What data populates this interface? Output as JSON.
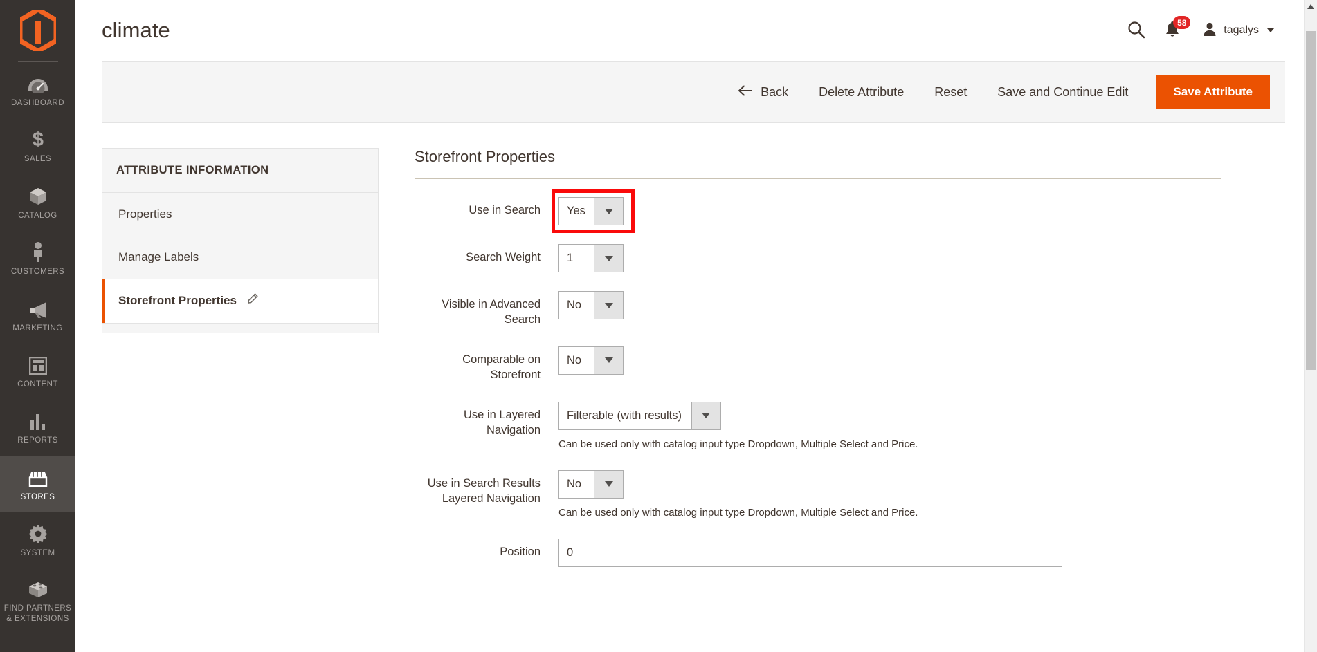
{
  "sidebar": {
    "logo": "magento-logo",
    "items": [
      {
        "label": "DASHBOARD",
        "icon": "dashboard-icon",
        "active": false
      },
      {
        "label": "SALES",
        "icon": "dollar-icon",
        "active": false
      },
      {
        "label": "CATALOG",
        "icon": "box-icon",
        "active": false
      },
      {
        "label": "CUSTOMERS",
        "icon": "person-icon",
        "active": false
      },
      {
        "label": "MARKETING",
        "icon": "megaphone-icon",
        "active": false
      },
      {
        "label": "CONTENT",
        "icon": "layout-icon",
        "active": false
      },
      {
        "label": "REPORTS",
        "icon": "bar-chart-icon",
        "active": false
      },
      {
        "label": "STORES",
        "icon": "storefront-icon",
        "active": true
      },
      {
        "label": "SYSTEM",
        "icon": "gear-icon",
        "active": false
      },
      {
        "label": "FIND PARTNERS\n& EXTENSIONS",
        "icon": "puzzle-block-icon",
        "active": false
      }
    ],
    "partners_line1": "FIND PARTNERS",
    "partners_line2": "& EXTENSIONS"
  },
  "header": {
    "title": "climate",
    "search_icon": "search-icon",
    "notifications_icon": "bell-icon",
    "notifications_count": "58",
    "user_icon": "user-avatar-icon",
    "user_name": "tagalys"
  },
  "toolbar": {
    "back": "Back",
    "delete_attribute": "Delete Attribute",
    "reset": "Reset",
    "save_and_continue": "Save and Continue Edit",
    "save_attribute": "Save Attribute",
    "primary_color": "#eb5202"
  },
  "tabs": {
    "title": "ATTRIBUTE INFORMATION",
    "items": [
      {
        "label": "Properties",
        "active": false
      },
      {
        "label": "Manage Labels",
        "active": false
      },
      {
        "label": "Storefront Properties",
        "active": true,
        "icon": "pencil-icon"
      }
    ]
  },
  "form": {
    "section_title": "Storefront Properties",
    "note_text": "Can be used only with catalog input type Dropdown, Multiple Select and Price.",
    "highlight_color": "#fa0a0a",
    "fields": [
      {
        "label": "Use in Search",
        "value": "Yes",
        "type": "select",
        "highlighted": true
      },
      {
        "label": "Search Weight",
        "value": "1",
        "type": "select"
      },
      {
        "label": "Visible in Advanced Search",
        "label_l1": "Visible in Advanced",
        "label_l2": "Search",
        "value": "No",
        "type": "select"
      },
      {
        "label": "Comparable on Storefront",
        "label_l1": "Comparable on",
        "label_l2": "Storefront",
        "value": "No",
        "type": "select"
      },
      {
        "label": "Use in Layered Navigation",
        "label_l1": "Use in Layered",
        "label_l2": "Navigation",
        "value": "Filterable (with results)",
        "type": "select",
        "note": "Can be used only with catalog input type Dropdown, Multiple Select and Price."
      },
      {
        "label": "Use in Search Results Layered Navigation",
        "label_l1": "Use in Search Results",
        "label_l2": "Layered Navigation",
        "value": "No",
        "type": "select",
        "note": "Can be used only with catalog input type Dropdown, Multiple Select and Price."
      },
      {
        "label": "Position",
        "value": "0",
        "type": "text"
      }
    ]
  }
}
